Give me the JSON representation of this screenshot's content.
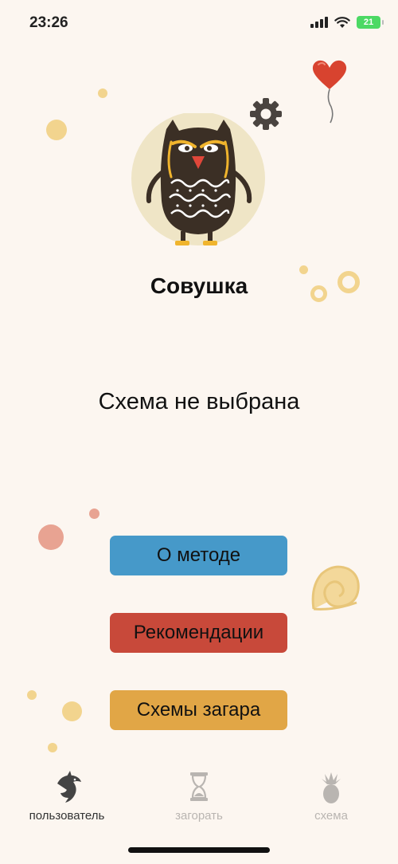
{
  "status_bar": {
    "time": "23:26",
    "battery": "21"
  },
  "profile": {
    "name": "Совушка"
  },
  "scheme": {
    "status": "Схема не выбрана"
  },
  "buttons": {
    "method": "О методе",
    "recommendations": "Рекомендации",
    "schemes": "Схемы загара"
  },
  "tabs": [
    {
      "label": "пользователь",
      "icon": "dolphin-icon",
      "active": true
    },
    {
      "label": "загорать",
      "icon": "hourglass-icon",
      "active": false
    },
    {
      "label": "схема",
      "icon": "pineapple-icon",
      "active": false
    }
  ],
  "colors": {
    "background": "#fcf6f0",
    "method_button": "#4699c9",
    "recommendations_button": "#c8493a",
    "schemes_button": "#e1a646",
    "tab_active": "#333333",
    "tab_inactive": "#b9b5b1"
  }
}
